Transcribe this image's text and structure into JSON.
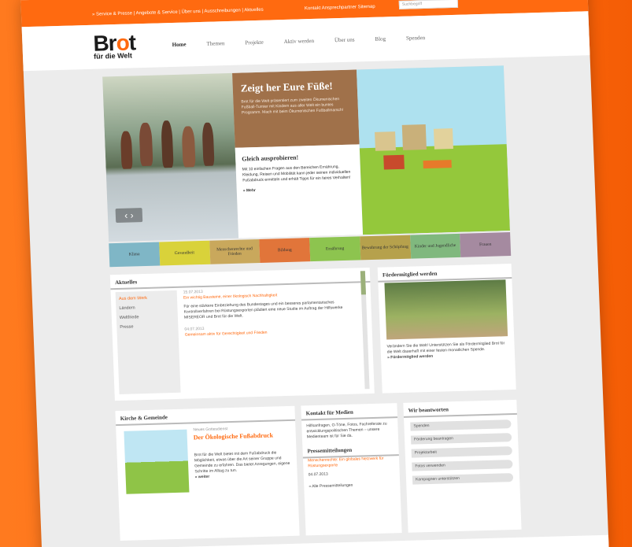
{
  "brand": {
    "name_part1": "Br",
    "name_o": "o",
    "name_part2": "t",
    "tagline": "für die Welt"
  },
  "topbar": {
    "links": "» Service & Presse | Angebote & Service | Über uns | Ausschreibungen | Aktuelles",
    "util": "Kontakt  Ansprechpartner  Sitemap",
    "search_placeholder": "Suchbegriff"
  },
  "mainnav": [
    "Home",
    "Themen",
    "Projekte",
    "Aktiv werden",
    "Über uns",
    "Blog",
    "Spenden"
  ],
  "hero": {
    "title": "Zeigt her Eure Füße!",
    "intro": "Brot für die Welt präsentiert zum zweiten Ökumenischen Fußball-Turnier mit Kindern aus aller Welt ein buntes Programm. Mach mit beim Ökumenischen Fußballmarsch!",
    "box_title": "Gleich ausprobieren!",
    "box_text": "Mit 10 einfachen Fragen aus den Bereichen Ernährung, Kleidung, Reisen und Mobilität kann jeder seinen individuellen Fußabdruck ermitteln und erhält Tipps für ein faires Verhalten!",
    "more": "» Mehr",
    "arrows": "‹ ›"
  },
  "categories": [
    {
      "label": "Klima",
      "color": "#7fb6c6"
    },
    {
      "label": "Gesundheit",
      "color": "#d9d23a"
    },
    {
      "label": "Menschenrechte und Frieden",
      "color": "#c9a85c"
    },
    {
      "label": "Bildung",
      "color": "#e1753a"
    },
    {
      "label": "Ernährung",
      "color": "#8dc44f"
    },
    {
      "label": "Bewahrung der Schöpfung",
      "color": "#b6a14c"
    },
    {
      "label": "Kinder und Jugendliche",
      "color": "#80b87e"
    },
    {
      "label": "Frauen",
      "color": "#a58aa0"
    }
  ],
  "news": {
    "title": "Aktuelles",
    "tabs": [
      "Aus dem Werk",
      "Ländern",
      "Weltfriede",
      "Presse"
    ],
    "items": [
      {
        "date": "15.07.2013",
        "title": "Ein wichtig Bausteine, einer ökologisch Nachhaltigkeit",
        "text": "Für eine stärkere Einbeziehung des Bundestages und ein besseres parlamentarisches Kontrollverfahren bei Rüstungsexporten plädiert eine neue Studie im Auftrag der Hilfswerke MISEREOR und Brot für die Welt."
      },
      {
        "date": "04.07.2013",
        "title": "Gemeinsam aktiv für Gerechtigkeit und Frieden",
        "text": ""
      }
    ]
  },
  "member": {
    "title": "Fördermitglied werden",
    "text": "Verändern Sie die Welt! Unterstützen Sie als Fördermitglied Brot für die Welt dauerhaft mit einer festen monatlichen Spende.",
    "link": "» Fördermitglied werden"
  },
  "church": {
    "title": "Kirche & Gemeinde",
    "sub": "Neues Gottesdienst",
    "headline": "Der Ökologische Fußabdruck",
    "text": "Brot für die Welt bietet mit dem Fußabdruck die Möglichkeit, etwas über die Art seiner Gruppe und Gemeinde zu erfahren. Das bietet Anregungen, eigene Schritte im Alltag zu tun.",
    "more": "» weiter"
  },
  "contact": {
    "title": "Kontakt für Medien",
    "text": "Hilfsanfragen, O-Töne, Fotos, Fachreferate zu entwicklungspolitischen Themen – unsere Medienteam ist für Sie da.",
    "press_title": "Pressemitteilungen",
    "press_text": "Menschenrechte: Ein globales Netzwerk für Rüstungsexporte",
    "press_date": "04.07.2013",
    "press_more": "» Alle Pressemitteilungen"
  },
  "faq": {
    "title": "Wir beantworten",
    "items": [
      "Spenden",
      "Förderung beantragen",
      "Projektarbeit",
      "Fotos verwenden",
      "Kampagnen unterstützen"
    ]
  }
}
